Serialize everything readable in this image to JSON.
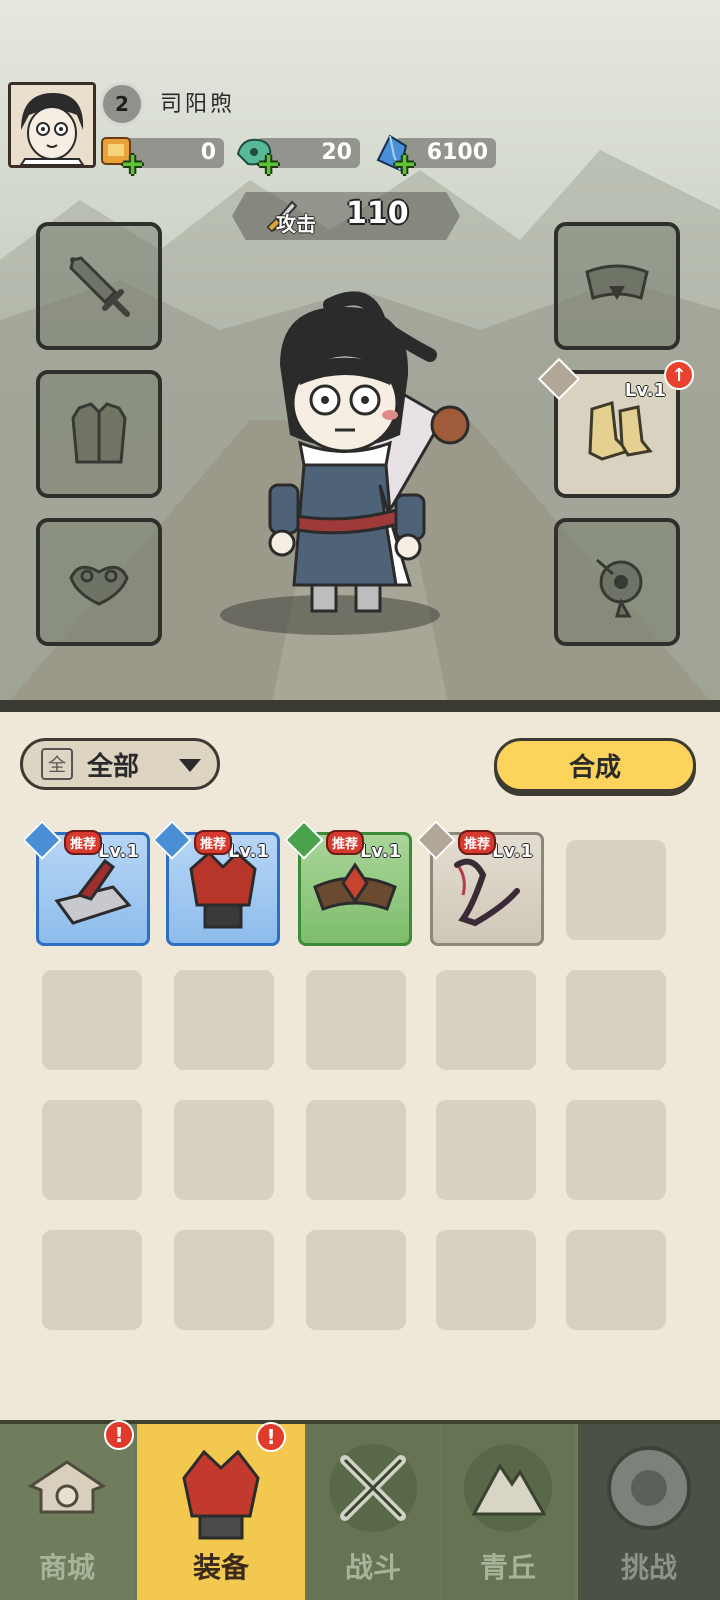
{
  "player": {
    "level": "2",
    "name": "司阳煦"
  },
  "resources": [
    {
      "name": "scroll-token",
      "value": "0"
    },
    {
      "name": "jade-coin",
      "value": "20"
    },
    {
      "name": "blue-crystal",
      "value": "6100"
    }
  ],
  "attack": {
    "label": "攻击",
    "value": "110"
  },
  "equipment_slots": {
    "left": [
      "sword-slot",
      "armor-slot",
      "amulet-slot"
    ],
    "right": [
      {
        "icon": "belt-slot",
        "level": ""
      },
      {
        "icon": "boots-slot",
        "level": "Lv.1",
        "upgrade": true
      },
      {
        "icon": "ornament-slot",
        "level": ""
      }
    ]
  },
  "inventory": {
    "filter_label": "全部",
    "filter_box": "全",
    "synthesize_label": "合成",
    "items": [
      {
        "type": "weapon",
        "rarity": "blue",
        "level": "Lv.1",
        "tag": "推荐"
      },
      {
        "type": "armor",
        "rarity": "blue",
        "level": "Lv.1",
        "tag": "推荐"
      },
      {
        "type": "belt",
        "rarity": "green",
        "level": "Lv.1",
        "tag": "推荐"
      },
      {
        "type": "amulet",
        "rarity": "gray",
        "level": "Lv.1",
        "tag": "推荐"
      }
    ]
  },
  "nav": {
    "tabs": [
      {
        "label": "商城",
        "alert": "!"
      },
      {
        "label": "装备",
        "alert": "!"
      },
      {
        "label": "战斗"
      },
      {
        "label": "青丘"
      },
      {
        "label": "挑战"
      }
    ]
  },
  "colors": {
    "accent_yellow": "#fcd45c",
    "rarity_blue": "#2f6fc2",
    "rarity_green": "#3c8c37",
    "alert_red": "#e23a2a"
  }
}
